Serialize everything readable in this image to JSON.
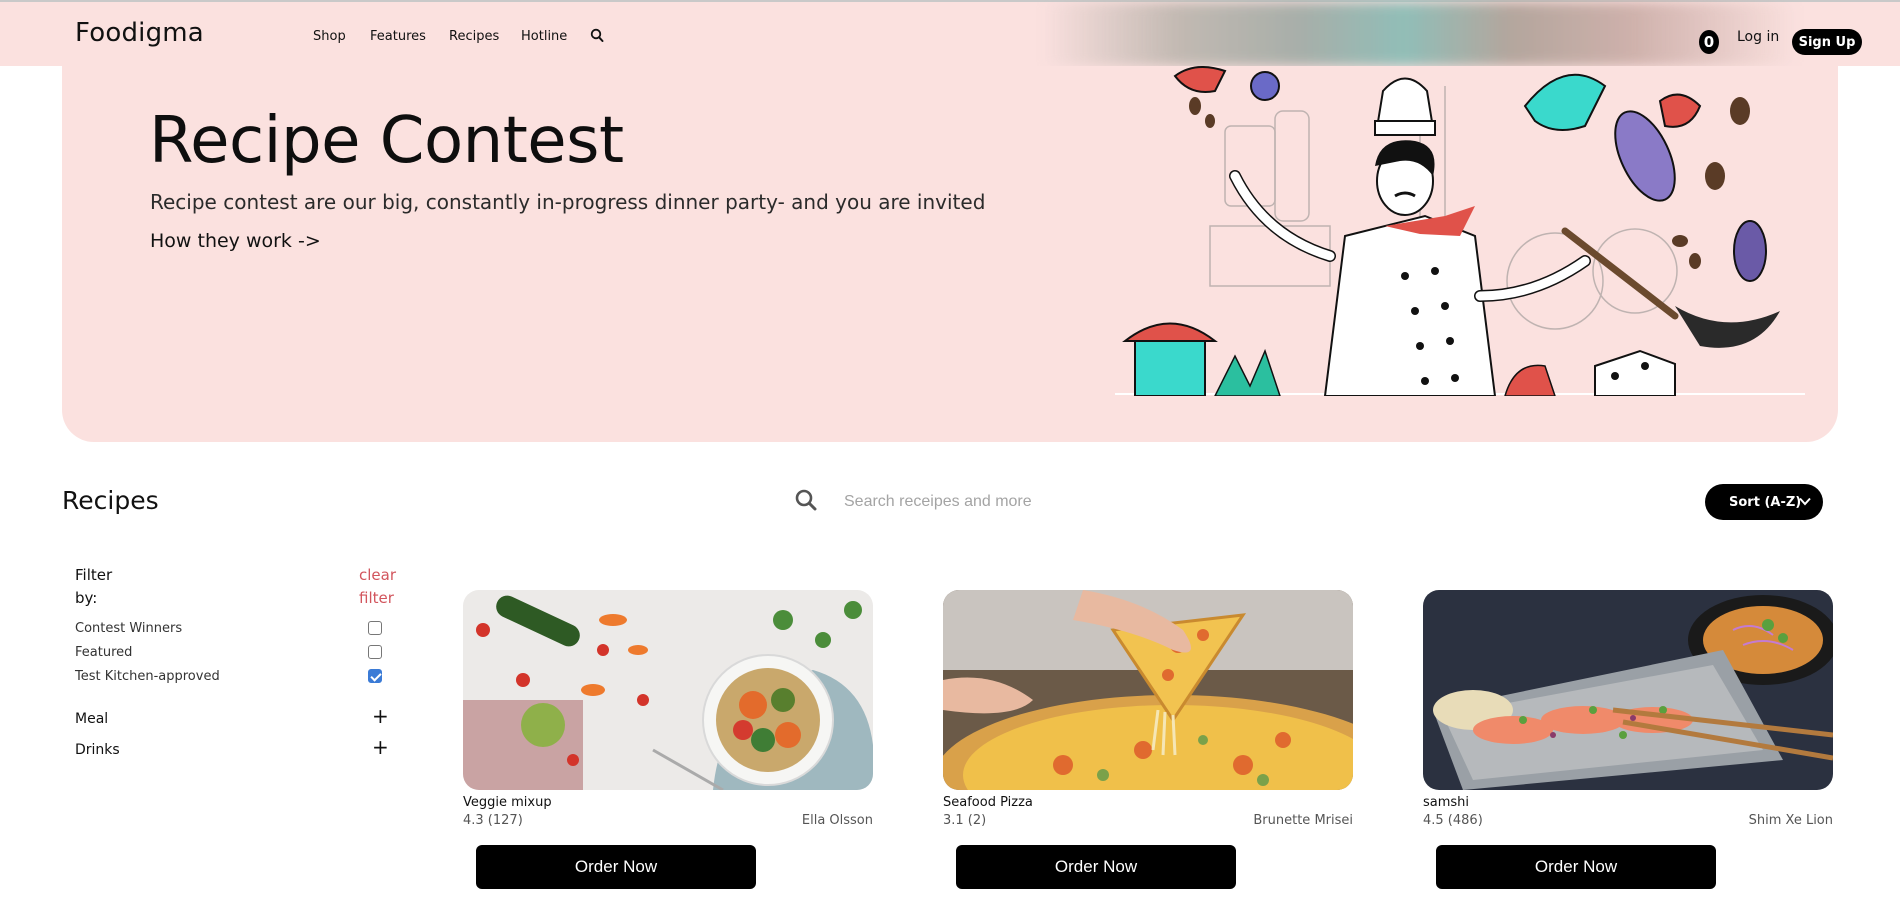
{
  "header": {
    "logo": "Foodigma",
    "nav": [
      "Shop",
      "Features",
      "Recipes",
      "Hotline"
    ],
    "cart_count": "0",
    "login": "Log in",
    "signup": "Sign Up"
  },
  "hero": {
    "title": "Recipe Contest",
    "subtitle": "Recipe contest are our big, constantly in-progress dinner party- and you are invited",
    "link": "How they work ->"
  },
  "recipes_section": {
    "title": "Recipes",
    "search_placeholder": "Search receipes and more",
    "sort_label": "Sort (A-Z)"
  },
  "filter": {
    "heading_line1": "Filter",
    "heading_line2": "by:",
    "clear_line1": "clear",
    "clear_line2": "filter",
    "options": [
      {
        "label": "Contest Winners",
        "checked": false
      },
      {
        "label": "Featured",
        "checked": false
      },
      {
        "label": "Test Kitchen-approved",
        "checked": true
      }
    ],
    "accordions": [
      "Meal",
      "Drinks"
    ]
  },
  "cards": [
    {
      "name": "Veggie mixup",
      "rating": "4.3 (127)",
      "author": "Ella Olsson",
      "button": "Order Now"
    },
    {
      "name": "Seafood Pizza",
      "rating": "3.1 (2)",
      "author": "Brunette Mrisei",
      "button": "Order Now"
    },
    {
      "name": "samshi",
      "rating": "4.5 (486)",
      "author": "Shim Xe Lion",
      "button": "Order Now"
    }
  ],
  "colors": {
    "hero_bg": "#fbe1df",
    "accent_red": "#d2555d",
    "button_black": "#000000"
  }
}
